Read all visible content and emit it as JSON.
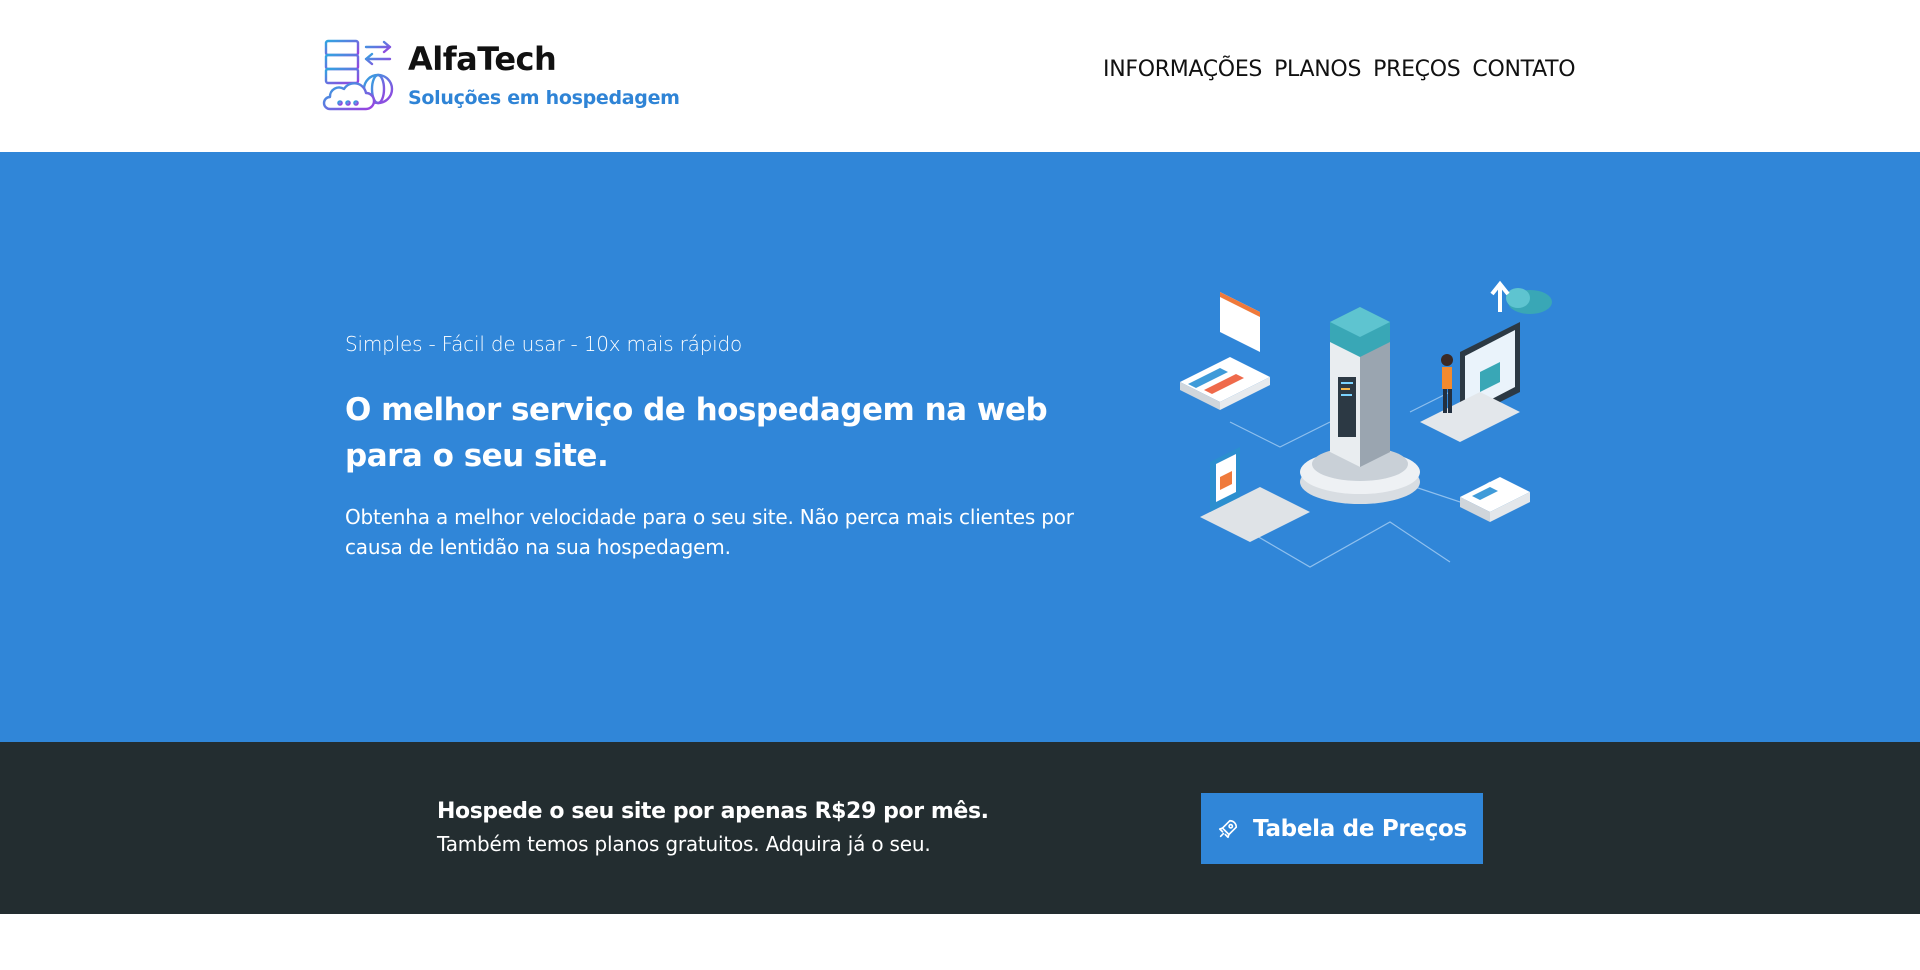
{
  "brand": {
    "name": "AlfaTech",
    "tagline": "Soluções em hospedagem",
    "logo_icon": "server-cloud-icon"
  },
  "nav": {
    "items": [
      {
        "label": "INFORMAÇÕES"
      },
      {
        "label": "PLANOS"
      },
      {
        "label": "PREÇOS"
      },
      {
        "label": "CONTATO"
      }
    ]
  },
  "hero": {
    "kicker": "Simples - Fácil de usar - 10x mais rápido",
    "title": "O melhor serviço de hospedagem na web para o seu site.",
    "description": "Obtenha a melhor velocidade para o seu site. Não perca mais clientes por causa de lentidão na sua hospedagem.",
    "illustration": "isometric-hosting-illustration",
    "background_color": "#3086d8"
  },
  "cta": {
    "headline": "Hospede o seu site por apenas R$29 por mês.",
    "subtext": "Também temos planos gratuitos. Adquira já o seu.",
    "button_label": "Tabela de Preços",
    "button_icon": "rocket-icon",
    "background_color": "#232d30"
  }
}
